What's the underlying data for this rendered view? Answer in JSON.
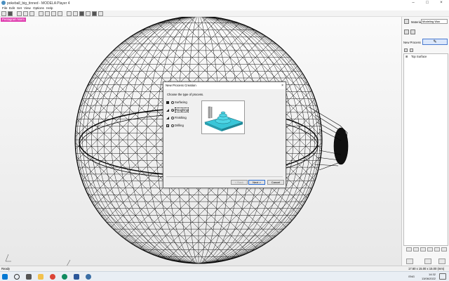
{
  "window": {
    "title": "pokeball_big_tinned - MODELA Player 4"
  },
  "menu": [
    "File",
    "Edit",
    "Set",
    "View",
    "Options",
    "Help"
  ],
  "viewport": {
    "tag": "Pentagram Norm"
  },
  "right_panel": {
    "material_label": "Material",
    "material_value": "Modeling Wax",
    "new_process_label": "New Process",
    "tree_item": "Top Surface"
  },
  "status": {
    "left": "Ready",
    "dims": "17.60 x 15.00 x 15.00 (mm)"
  },
  "taskbar": {
    "lang": "ENG",
    "time": "14:32",
    "date": "13/06/2022"
  },
  "dialog": {
    "title": "New Process Creation",
    "close": "×",
    "prompt": "Choose the type of process.",
    "options": [
      {
        "label": "Surfacing",
        "selected": false
      },
      {
        "label": "Roughing",
        "selected": true
      },
      {
        "label": "Finishing",
        "selected": false
      },
      {
        "label": "Drilling",
        "selected": false
      }
    ],
    "back": "< Back",
    "next": "Next >",
    "cancel": "Cancel"
  }
}
